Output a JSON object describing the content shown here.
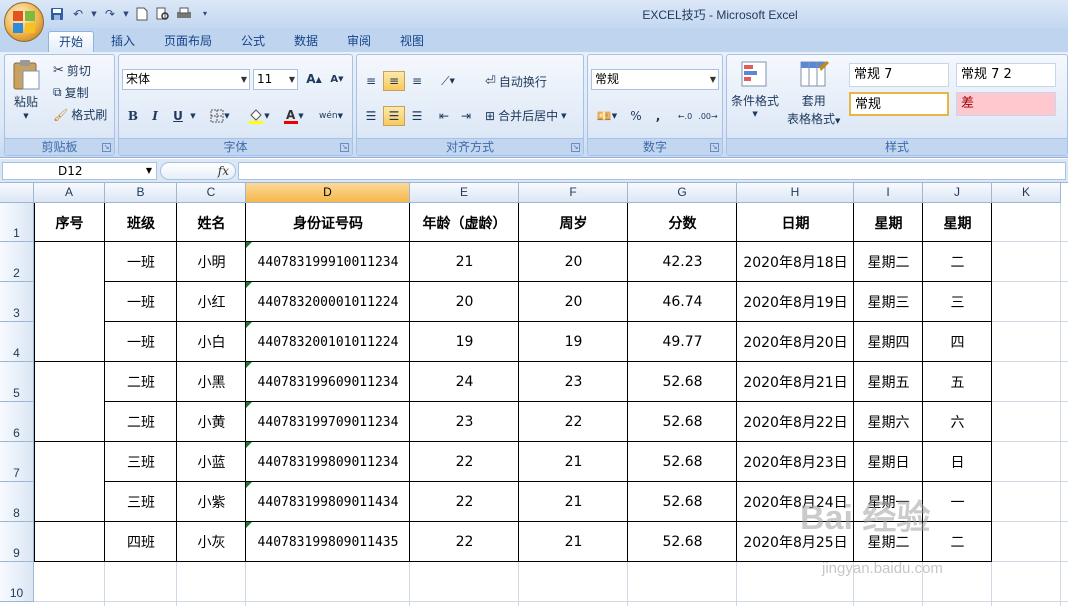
{
  "window": {
    "title": "EXCEL技巧 - Microsoft Excel"
  },
  "quick_access": [
    {
      "icon": "save-icon"
    },
    {
      "icon": "undo-icon"
    },
    {
      "icon": "redo-icon"
    },
    {
      "icon": "new-icon"
    },
    {
      "icon": "print-preview-icon"
    },
    {
      "icon": "print-icon"
    },
    {
      "icon": "customize-icon"
    }
  ],
  "tabs": [
    "开始",
    "插入",
    "页面布局",
    "公式",
    "数据",
    "审阅",
    "视图"
  ],
  "ribbon": {
    "clipboard": {
      "label": "剪贴板",
      "paste": "粘贴",
      "cut": "剪切",
      "copy": "复制",
      "format_painter": "格式刷"
    },
    "font": {
      "label": "字体",
      "font_name": "宋体",
      "font_size": "11",
      "bold": "B",
      "italic": "I",
      "underline": "U",
      "phonetic": "wén"
    },
    "alignment": {
      "label": "对齐方式",
      "wrap_text": "自动换行",
      "merge_center": "合并后居中"
    },
    "number": {
      "label": "数字",
      "format": "常规",
      "percent": "%",
      "comma": ","
    },
    "styles": {
      "label": "样式",
      "conditional_format": "条件格式",
      "format_as_table_1": "套用",
      "format_as_table_2": "表格格式",
      "style_cells": [
        "常规 7",
        "常规 7 2",
        "常规",
        "差"
      ]
    }
  },
  "formula_bar": {
    "name_box": "D12",
    "fx": "fx",
    "formula": ""
  },
  "columns": [
    "A",
    "B",
    "C",
    "D",
    "E",
    "F",
    "G",
    "H",
    "I",
    "J",
    "K"
  ],
  "selected_column": "D",
  "rows": [
    "1",
    "2",
    "3",
    "4",
    "5",
    "6",
    "7",
    "8",
    "9",
    "10"
  ],
  "table": {
    "headers": [
      "序号",
      "班级",
      "姓名",
      "身份证号码",
      "年龄（虚龄）",
      "周岁",
      "分数",
      "日期",
      "星期",
      "星期"
    ],
    "data": [
      [
        "",
        "一班",
        "小明",
        "440783199910011234",
        "21",
        "20",
        "42.23",
        "2020年8月18日",
        "星期二",
        "二"
      ],
      [
        "",
        "一班",
        "小红",
        "440783200001011224",
        "20",
        "20",
        "46.74",
        "2020年8月19日",
        "星期三",
        "三"
      ],
      [
        "",
        "一班",
        "小白",
        "440783200101011224",
        "19",
        "19",
        "49.77",
        "2020年8月20日",
        "星期四",
        "四"
      ],
      [
        "",
        "二班",
        "小黑",
        "440783199609011234",
        "24",
        "23",
        "52.68",
        "2020年8月21日",
        "星期五",
        "五"
      ],
      [
        "",
        "二班",
        "小黄",
        "440783199709011234",
        "23",
        "22",
        "52.68",
        "2020年8月22日",
        "星期六",
        "六"
      ],
      [
        "",
        "三班",
        "小蓝",
        "440783199809011234",
        "22",
        "21",
        "52.68",
        "2020年8月23日",
        "星期日",
        "日"
      ],
      [
        "",
        "三班",
        "小紫",
        "440783199809011434",
        "22",
        "21",
        "52.68",
        "2020年8月24日",
        "星期一",
        "一"
      ],
      [
        "",
        "四班",
        "小灰",
        "440783199809011435",
        "22",
        "21",
        "52.68",
        "2020年8月25日",
        "星期二",
        "二"
      ]
    ]
  },
  "watermark": {
    "main": "Bai 经验",
    "sub": "jingyan.baidu.com"
  }
}
